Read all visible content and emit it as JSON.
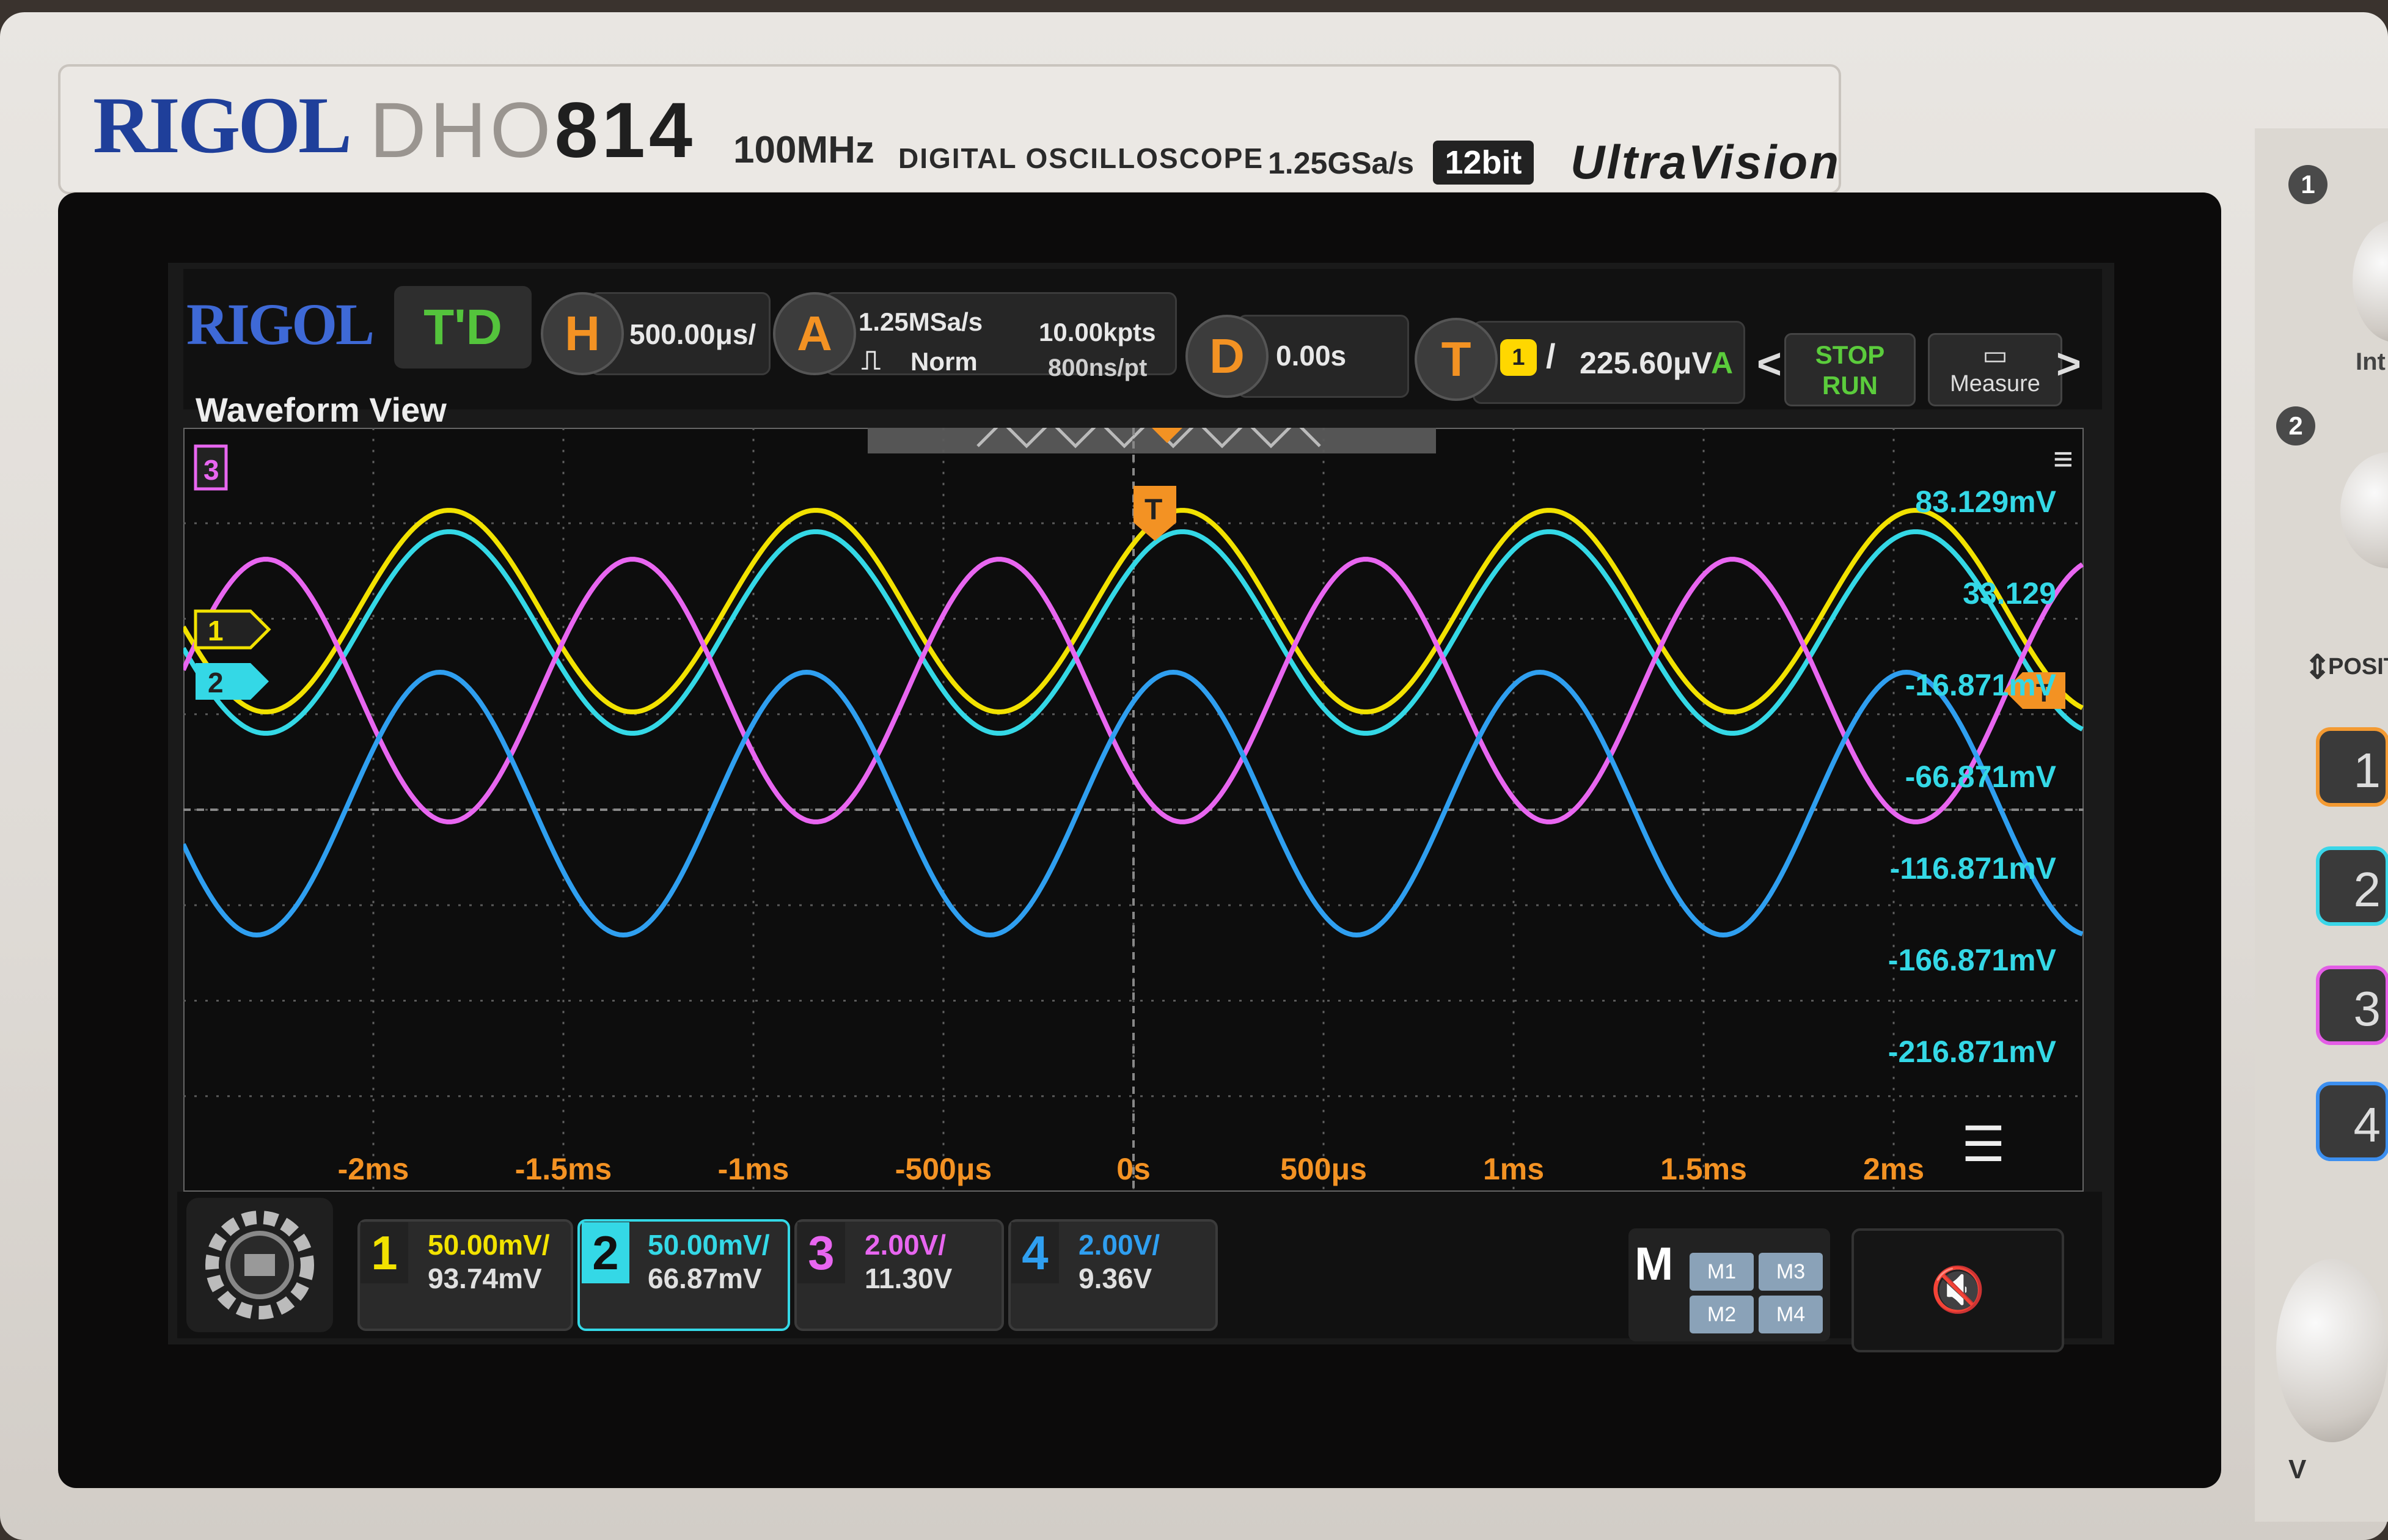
{
  "header": {
    "brand": "RIGOL",
    "model_prefix": "DHO",
    "model_number": "814",
    "bandwidth": "100MHz",
    "description": "DIGITAL OSCILLOSCOPE",
    "sample_rate": "1.25GSa/s",
    "resolution": "12bit",
    "series": "UltraVision"
  },
  "toolbar": {
    "logo": "RIGOL",
    "td_label": "T'D",
    "horizontal_badge": "H",
    "timebase": "500.00μs/",
    "acquire_badge": "A",
    "acq_rate": "1.25MSa/s",
    "acq_mode": "Norm",
    "memory_depth": "10.00kpts",
    "time_per_point": "800ns/pt",
    "delay_badge": "D",
    "delay_value": "0.00s",
    "trigger_badge": "T",
    "trigger_source": "1",
    "trigger_slope": "/",
    "trigger_level": "225.60μV",
    "trigger_mode": "A",
    "stop_label": "STOP",
    "run_label": "RUN",
    "measure_label": "Measure",
    "prev_arrow": "<",
    "next_arrow": ">"
  },
  "waveform_view": {
    "title": "Waveform View",
    "channel_markers": [
      "3",
      "1",
      "2"
    ],
    "trigger_marker": "T",
    "y_labels": [
      "83.129mV",
      "33.129",
      "-16.871mV",
      "-66.871mV",
      "-116.871mV",
      "-166.871mV",
      "-216.871mV"
    ],
    "x_labels": [
      "-2ms",
      "-1.5ms",
      "-1ms",
      "-500μs",
      "0s",
      "500μs",
      "1ms",
      "1.5ms",
      "2ms"
    ]
  },
  "channels": [
    {
      "num": "1",
      "scale": "50.00mV/",
      "offset": "93.74mV",
      "color": "#f2e200"
    },
    {
      "num": "2",
      "scale": "50.00mV/",
      "offset": "66.87mV",
      "color": "#34d8e6"
    },
    {
      "num": "3",
      "scale": "2.00V/",
      "offset": "11.30V",
      "color": "#e866f0"
    },
    {
      "num": "4",
      "scale": "2.00V/",
      "offset": "9.36V",
      "color": "#2f9ff0"
    }
  ],
  "math": {
    "label": "M",
    "m1": "M1",
    "m2": "M2",
    "m3": "M3",
    "m4": "M4"
  },
  "side_panel": {
    "badge_1": "1",
    "badge_2": "2",
    "posit_label": "POSIT",
    "int_label": "Int",
    "v_label": "V",
    "ch_buttons": [
      "1",
      "2",
      "3",
      "4"
    ]
  },
  "colors": {
    "ch1": "#f2e200",
    "ch2": "#34d8e6",
    "ch3": "#e866f0",
    "ch4": "#2f9ff0",
    "trigger": "#f39223",
    "grid": "#5a5a5a"
  }
}
